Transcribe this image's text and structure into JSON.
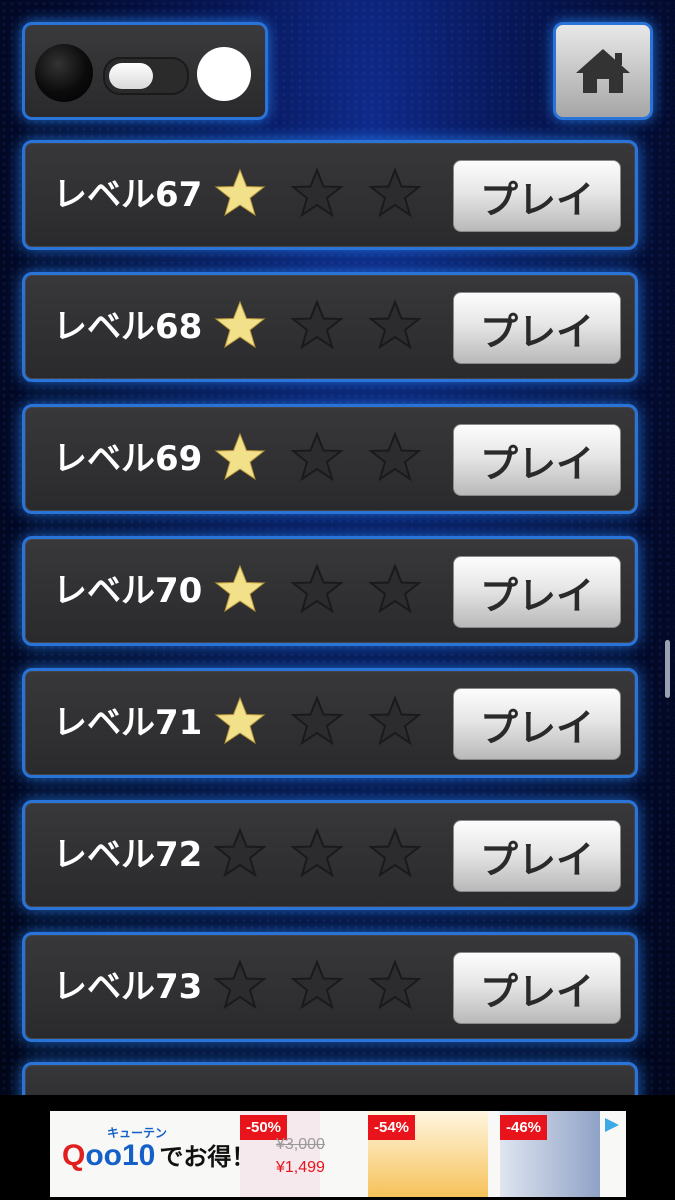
{
  "colors": {
    "accent": "#2a74d9",
    "star_on": "#f2e08a",
    "star_off": "#2c2c2e"
  },
  "levels": [
    {
      "label": "レベル67",
      "stars": 1,
      "button": "プレイ"
    },
    {
      "label": "レベル68",
      "stars": 1,
      "button": "プレイ"
    },
    {
      "label": "レベル69",
      "stars": 1,
      "button": "プレイ"
    },
    {
      "label": "レベル70",
      "stars": 1,
      "button": "プレイ"
    },
    {
      "label": "レベル71",
      "stars": 1,
      "button": "プレイ"
    },
    {
      "label": "レベル72",
      "stars": 0,
      "button": "プレイ"
    },
    {
      "label": "レベル73",
      "stars": 0,
      "button": "プレイ"
    }
  ],
  "ad": {
    "brand_sub": "キューテン",
    "brand_q": "Q",
    "brand_rest": "oo10",
    "tagline": "でお得！",
    "discounts": [
      "-50%",
      "-54%",
      "-46%"
    ],
    "price_old": "¥3,000",
    "price_new": "¥1,499"
  }
}
